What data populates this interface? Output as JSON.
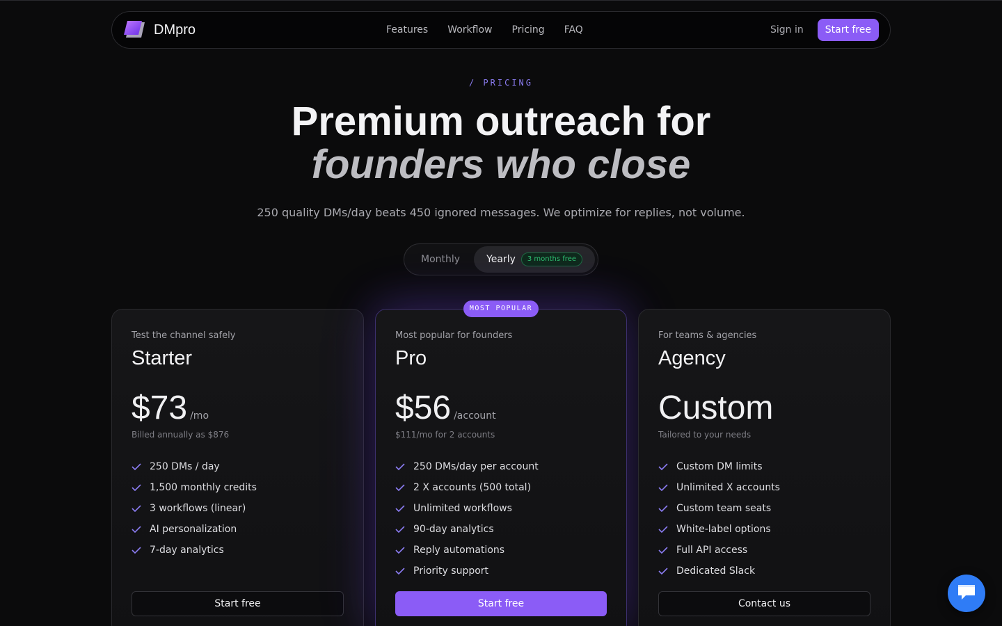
{
  "nav": {
    "brand": "DMpro",
    "links": [
      {
        "label": "Features"
      },
      {
        "label": "Workflow"
      },
      {
        "label": "Pricing"
      },
      {
        "label": "FAQ"
      }
    ],
    "sign_in": "Sign in",
    "cta": "Start free"
  },
  "hero": {
    "eyebrow": "/ PRICING",
    "title_line1": "Premium outreach for",
    "title_line2": "founders who close",
    "subtitle": "250 quality DMs/day beats 450 ignored messages. We optimize for replies, not volume."
  },
  "billing_toggle": {
    "monthly": "Monthly",
    "yearly": "Yearly",
    "yearly_badge": "3 months free",
    "selected": "Yearly"
  },
  "plans": [
    {
      "tagline": "Test the channel safely",
      "name": "Starter",
      "price": "$73",
      "unit": "/mo",
      "note": "Billed annually as $876",
      "features": [
        "250 DMs / day",
        "1,500 monthly credits",
        "3 workflows (linear)",
        "AI personalization",
        "7-day analytics"
      ],
      "cta": "Start free"
    },
    {
      "badge": "MOST POPULAR",
      "tagline": "Most popular for founders",
      "name": "Pro",
      "price": "$56",
      "unit": "/account",
      "note": "$111/mo for 2 accounts",
      "features": [
        "250 DMs/day per account",
        "2 X accounts (500 total)",
        "Unlimited workflows",
        "90-day analytics",
        "Reply automations",
        "Priority support"
      ],
      "cta": "Start free"
    },
    {
      "tagline": "For teams & agencies",
      "name": "Agency",
      "price": "Custom",
      "unit": "",
      "note": "Tailored to your needs",
      "features": [
        "Custom DM limits",
        "Unlimited X accounts",
        "Custom team seats",
        "White-label options",
        "Full API access",
        "Dedicated Slack"
      ],
      "cta": "Contact us"
    }
  ],
  "colors": {
    "accent": "#8b5cf6",
    "background": "#0b0b0c",
    "success": "#2fbf71",
    "chat": "#2f7cf6"
  },
  "icons": {
    "logo": "dmpro-logo-icon",
    "check": "check-icon",
    "chat": "chat-bubble-icon"
  }
}
